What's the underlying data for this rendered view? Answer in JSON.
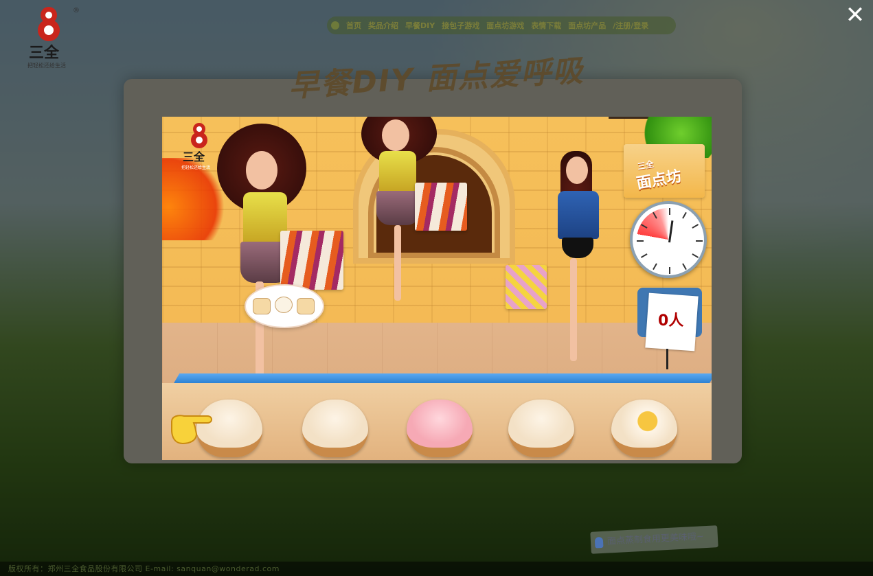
{
  "brand": {
    "name": "三全",
    "tagline": "把轻松还给生活",
    "trademark": "®"
  },
  "nav": {
    "items": [
      "首页",
      "奖品介绍",
      "早餐DIY",
      "接包子游戏",
      "面点坊游戏",
      "表情下载",
      "面点坊产品",
      "/注册/登录"
    ]
  },
  "banner_title": "早餐DIY 面点爱呼吸",
  "close_label": "✕",
  "game": {
    "badge_small": "三全",
    "badge_big": "面点坊",
    "customer_count": "0人",
    "order_items": 3,
    "timer_fraction_elapsed": 0.08,
    "steamers": [
      "xiaolongbao",
      "mantou",
      "taozi-bun",
      "nainhuang-bun",
      "egg-bun"
    ]
  },
  "hint_text": "面点蒸制食用更美味哦~",
  "footer_text": "版权所有：郑州三全食品股份有限公司   E-mail: sanquan@wonderad.com",
  "colors": {
    "accent": "#2176c9",
    "timer_red": "#ff2a2a",
    "count_red": "#b00000"
  }
}
